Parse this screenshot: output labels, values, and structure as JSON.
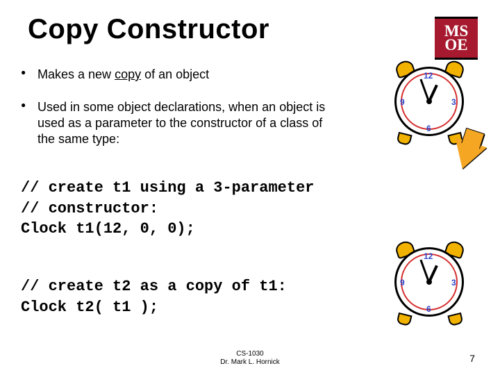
{
  "title": "Copy Constructor",
  "logo": {
    "line1": "MS",
    "line2": "OE"
  },
  "bullets": {
    "b1_pre": "Makes a new ",
    "b1_underlined": "copy",
    "b1_post": " of an object",
    "b2": "Used in some object declarations, when an object is used as a parameter to the constructor of a class of the same type:"
  },
  "code": {
    "block1": "// create t1 using a 3-parameter\n// constructor:\nClock t1(12, 0, 0);",
    "block2": "// create t2 as a copy of t1:\nClock t2( t1 );"
  },
  "clock_numerals": {
    "n12": "12",
    "n3": "3",
    "n6": "6",
    "n9": "9"
  },
  "footer": {
    "line1": "CS-1030",
    "line2": "Dr. Mark L. Hornick"
  },
  "page_number": "7"
}
